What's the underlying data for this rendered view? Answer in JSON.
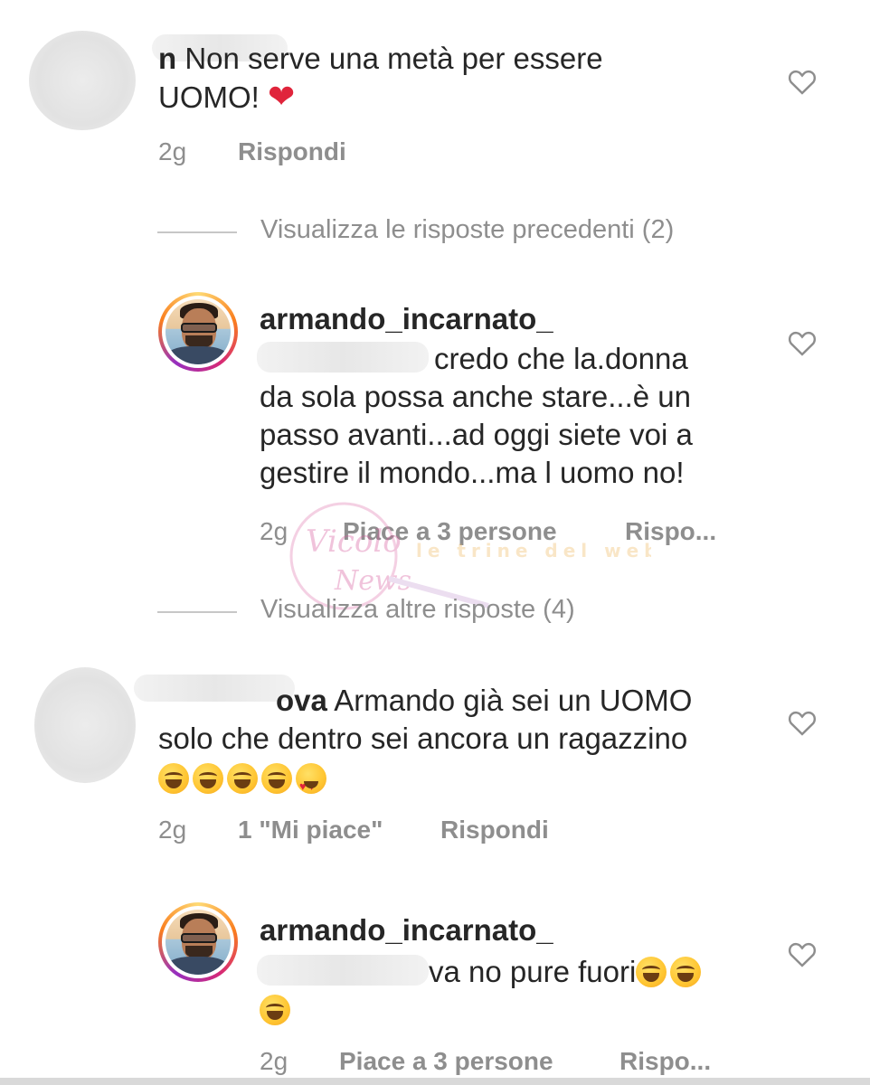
{
  "comments": [
    {
      "username_redacted": true,
      "username_tail": "n",
      "text": "Non serve una metà per essere UOMO!",
      "emoji": "red-heart",
      "time": "2g",
      "reply": "Rispondi"
    },
    {
      "username": "armando_incarnato_",
      "mention_tail": "credo che la.donna",
      "text_lines": [
        "da sola possa anche stare...è un",
        "passo avanti...ad oggi siete voi a",
        "gestire il mondo...ma l uomo no!"
      ],
      "time": "2g",
      "likes": "Piace a 3 persone",
      "reply": "Rispo..."
    },
    {
      "username_redacted": true,
      "username_tail": "ova",
      "text_line1": "Armando già sei un UOMO",
      "text_line2": "solo che dentro sei ancora un ragazzino",
      "emojis": [
        "laugh",
        "laugh",
        "laugh",
        "laugh",
        "heart-eyes"
      ],
      "time": "2g",
      "likes": "1 \"Mi piace\"",
      "reply": "Rispondi"
    },
    {
      "username": "armando_incarnato_",
      "mention_tail": "va",
      "text": "no pure fuori",
      "emojis": [
        "laugh",
        "laugh",
        "laugh"
      ],
      "time": "2g",
      "likes": "Piace a 3 persone",
      "reply": "Rispo..."
    }
  ],
  "dividers": [
    {
      "label": "Visualizza le risposte precedenti (2)"
    },
    {
      "label": "Visualizza altre risposte (4)"
    }
  ],
  "watermark": {
    "brand": "Vicolo delle News",
    "tagline": "le trine del web"
  },
  "icons": {
    "like": "heart-outline-icon",
    "avatar": "avatar"
  },
  "colors": {
    "text": "#262626",
    "meta": "#8e8e8e",
    "divider": "#c7c7c7",
    "ring": "#d62976",
    "red_heart": "#e0243b"
  }
}
